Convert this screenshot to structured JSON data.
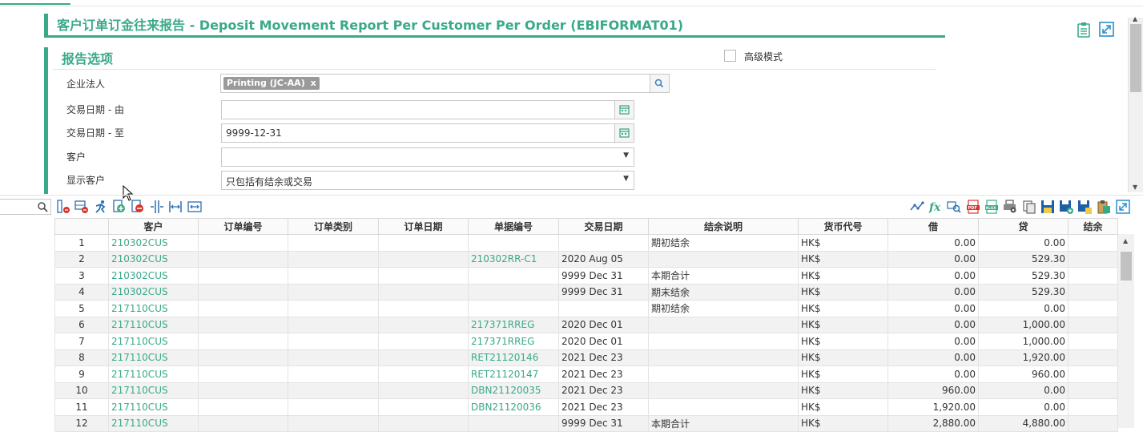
{
  "title": "客户订单订金往来报告 - Deposit Movement Report Per Customer Per Order (EBIFORMAT01)",
  "colors": {
    "accent": "#3aa98a",
    "link": "#3aa98a",
    "stripe": "#f2f2f2"
  },
  "icons": {
    "top": [
      "clipboard-icon",
      "expand-icon"
    ],
    "toolbar_left": [
      "remove-column-icon",
      "remove-row-icon",
      "run-icon",
      "add-page-icon",
      "remove-page-icon",
      "split-columns-icon",
      "fit-width-icon",
      "merge-cells-icon"
    ],
    "toolbar_right": [
      "trend-icon",
      "formula-icon",
      "zoom-icon",
      "pdf-icon",
      "xlsx-icon",
      "print-settings-icon",
      "copy-icon",
      "save-icon",
      "save-as-icon",
      "save-settings-icon",
      "paste-icon",
      "fullscreen-icon"
    ]
  },
  "options": {
    "section_title": "报告选项",
    "advanced_mode_label": "高级模式",
    "entity_label": "企业法人",
    "entity_tag": "Printing (JC-AA)",
    "tag_remove": "x",
    "date_from_label": "交易日期 - 由",
    "date_from_value": "",
    "date_to_label": "交易日期 - 至",
    "date_to_value": "9999-12-31",
    "customer_label": "客户",
    "customer_value": "",
    "show_customer_label": "显示客户",
    "show_customer_value": "只包括有结余或交易"
  },
  "grid": {
    "columns": [
      "",
      "客户",
      "订单编号",
      "订单类别",
      "订单日期",
      "单据编号",
      "交易日期",
      "结余说明",
      "货币代号",
      "借",
      "贷",
      "结余"
    ],
    "rows": [
      {
        "n": "1",
        "customer": "210302CUS",
        "order_no": "",
        "order_type": "",
        "order_date": "",
        "doc_no": "",
        "txn_date": "",
        "desc": "期初结余",
        "currency": "HK$",
        "debit": "0.00",
        "credit": "0.00",
        "balance": ""
      },
      {
        "n": "2",
        "customer": "210302CUS",
        "order_no": "",
        "order_type": "",
        "order_date": "",
        "doc_no": "210302RR-C1",
        "txn_date": "2020 Aug 05",
        "desc": "",
        "currency": "HK$",
        "debit": "0.00",
        "credit": "529.30",
        "balance": ""
      },
      {
        "n": "3",
        "customer": "210302CUS",
        "order_no": "",
        "order_type": "",
        "order_date": "",
        "doc_no": "",
        "txn_date": "9999 Dec 31",
        "desc": "本期合计",
        "currency": "HK$",
        "debit": "0.00",
        "credit": "529.30",
        "balance": ""
      },
      {
        "n": "4",
        "customer": "210302CUS",
        "order_no": "",
        "order_type": "",
        "order_date": "",
        "doc_no": "",
        "txn_date": "9999 Dec 31",
        "desc": "期末结余",
        "currency": "HK$",
        "debit": "0.00",
        "credit": "529.30",
        "balance": ""
      },
      {
        "n": "5",
        "customer": "217110CUS",
        "order_no": "",
        "order_type": "",
        "order_date": "",
        "doc_no": "",
        "txn_date": "",
        "desc": "期初结余",
        "currency": "HK$",
        "debit": "0.00",
        "credit": "0.00",
        "balance": ""
      },
      {
        "n": "6",
        "customer": "217110CUS",
        "order_no": "",
        "order_type": "",
        "order_date": "",
        "doc_no": "217371RREG",
        "txn_date": "2020 Dec 01",
        "desc": "",
        "currency": "HK$",
        "debit": "0.00",
        "credit": "1,000.00",
        "balance": ""
      },
      {
        "n": "7",
        "customer": "217110CUS",
        "order_no": "",
        "order_type": "",
        "order_date": "",
        "doc_no": "217371RREG",
        "txn_date": "2020 Dec 01",
        "desc": "",
        "currency": "HK$",
        "debit": "0.00",
        "credit": "1,000.00",
        "balance": ""
      },
      {
        "n": "8",
        "customer": "217110CUS",
        "order_no": "",
        "order_type": "",
        "order_date": "",
        "doc_no": "RET21120146",
        "txn_date": "2021 Dec 23",
        "desc": "",
        "currency": "HK$",
        "debit": "0.00",
        "credit": "1,920.00",
        "balance": ""
      },
      {
        "n": "9",
        "customer": "217110CUS",
        "order_no": "",
        "order_type": "",
        "order_date": "",
        "doc_no": "RET21120147",
        "txn_date": "2021 Dec 23",
        "desc": "",
        "currency": "HK$",
        "debit": "0.00",
        "credit": "960.00",
        "balance": ""
      },
      {
        "n": "10",
        "customer": "217110CUS",
        "order_no": "",
        "order_type": "",
        "order_date": "",
        "doc_no": "DBN21120035",
        "txn_date": "2021 Dec 23",
        "desc": "",
        "currency": "HK$",
        "debit": "960.00",
        "credit": "0.00",
        "balance": ""
      },
      {
        "n": "11",
        "customer": "217110CUS",
        "order_no": "",
        "order_type": "",
        "order_date": "",
        "doc_no": "DBN21120036",
        "txn_date": "2021 Dec 23",
        "desc": "",
        "currency": "HK$",
        "debit": "1,920.00",
        "credit": "0.00",
        "balance": ""
      },
      {
        "n": "12",
        "customer": "217110CUS",
        "order_no": "",
        "order_type": "",
        "order_date": "",
        "doc_no": "",
        "txn_date": "9999 Dec 31",
        "desc": "本期合计",
        "currency": "HK$",
        "debit": "2,880.00",
        "credit": "4,880.00",
        "balance": ""
      }
    ]
  }
}
